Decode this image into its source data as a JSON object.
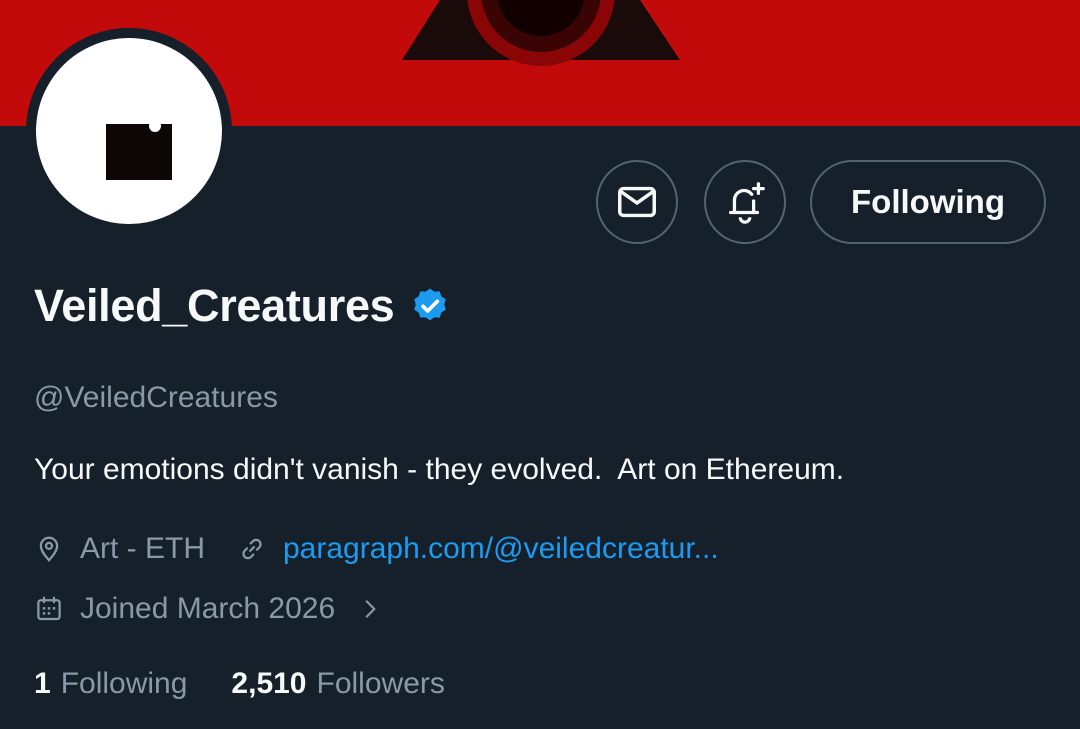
{
  "profile": {
    "display_name": "Veiled_Creatures",
    "handle": "@VeiledCreatures",
    "bio": "Your emotions didn't vanish - they evolved.  Art on Ethereum.",
    "location": "Art - ETH",
    "website": "paragraph.com/@veiledcreatur...",
    "joined": "Joined March 2026"
  },
  "actions": {
    "message_icon": "envelope-icon",
    "notify_icon": "bell-plus-icon",
    "follow_label": "Following"
  },
  "stats": {
    "following_count": "1",
    "following_label": "Following",
    "followers_count": "2,510",
    "followers_label": "Followers"
  },
  "colors": {
    "banner": "#c20a0a",
    "background": "#15202b",
    "link": "#1d9bf0",
    "verified": "#1d9bf0",
    "secondary_text": "#8b98a5"
  }
}
